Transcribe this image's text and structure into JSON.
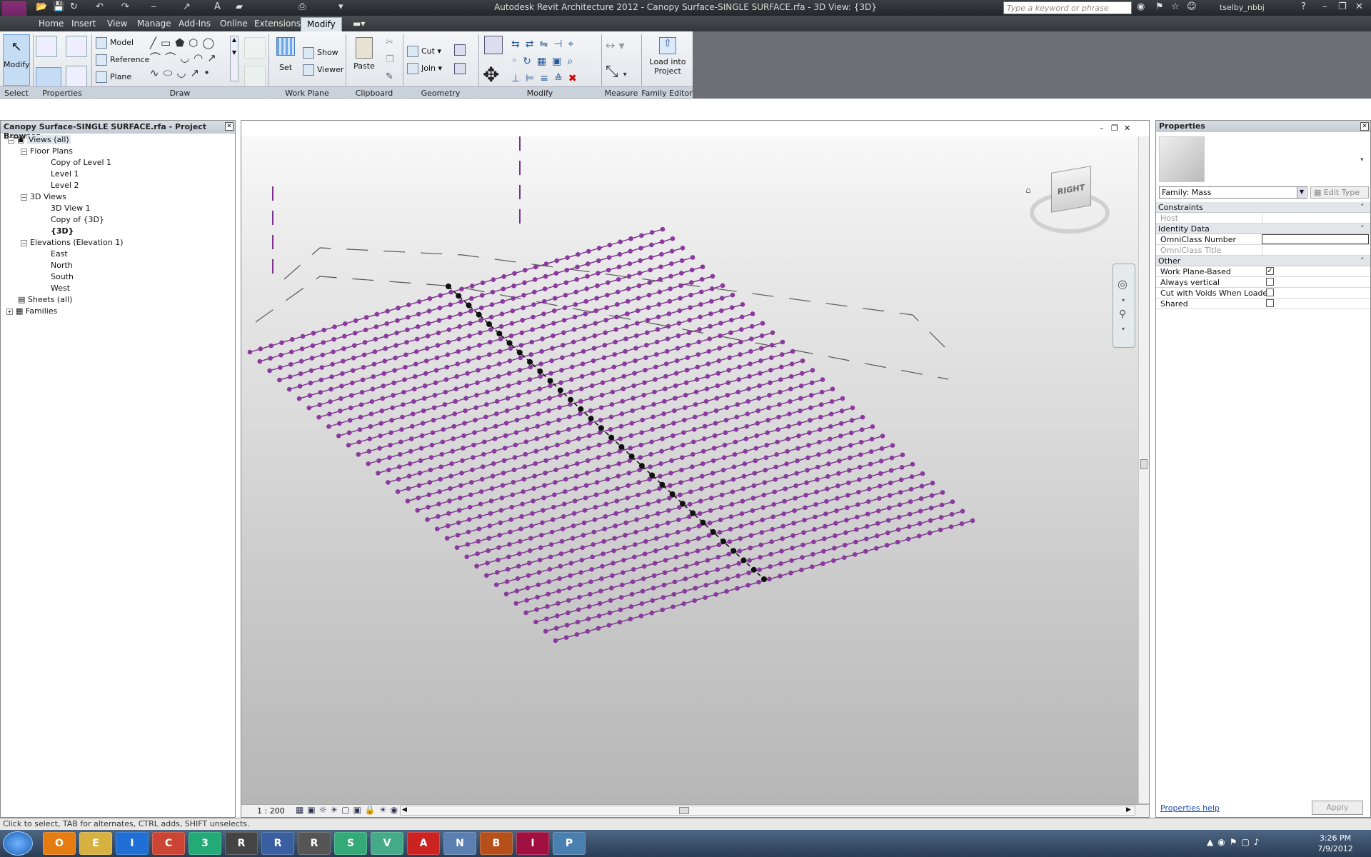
{
  "app": {
    "window_title": "Autodesk Revit Architecture 2012 -    Canopy Surface-SINGLE SURFACE.rfa - 3D View: {3D}",
    "search_placeholder": "Type a keyword or phrase",
    "user": "tselby_nbbj"
  },
  "tabs": [
    "Home",
    "Insert",
    "View",
    "Manage",
    "Add-Ins",
    "Online",
    "Extensions",
    "Modify"
  ],
  "active_tab": "Modify",
  "ribbon": {
    "select": {
      "modify": "Modify",
      "label": "Select"
    },
    "properties": {
      "label": "Properties"
    },
    "draw": {
      "model": "Model",
      "reference": "Reference",
      "plane": "Plane",
      "label": "Draw"
    },
    "work_plane": {
      "set": "Set",
      "show": "Show",
      "viewer": "Viewer",
      "label": "Work Plane"
    },
    "clipboard": {
      "paste": "Paste",
      "label": "Clipboard"
    },
    "geometry": {
      "cut": "Cut",
      "join": "Join",
      "label": "Geometry"
    },
    "modify": {
      "label": "Modify"
    },
    "measure": {
      "label": "Measure"
    },
    "family_editor": {
      "load": "Load into Project",
      "label": "Family Editor"
    }
  },
  "project_browser": {
    "title": "Canopy Surface-SINGLE SURFACE.rfa - Project Browser",
    "views_all": "Views (all)",
    "floor_plans": "Floor Plans",
    "fp1": "Copy of Level 1",
    "fp2": "Level 1",
    "fp3": "Level 2",
    "views3d": "3D Views",
    "v1": "3D View 1",
    "v2": "Copy of {3D}",
    "v3": "{3D}",
    "elevations": "Elevations (Elevation 1)",
    "e1": "East",
    "e2": "North",
    "e3": "South",
    "e4": "West",
    "sheets": "Sheets (all)",
    "families": "Families"
  },
  "viewport": {
    "scale": "1 : 200",
    "viewcube_face": "RIGHT",
    "colors": {
      "line": "#7b2f8e",
      "node": "#8a3a9e",
      "selected": "#111111"
    }
  },
  "properties": {
    "title": "Properties",
    "family": "Family: Mass",
    "edit_type": "Edit Type",
    "constraints": "Constraints",
    "host": "Host",
    "identity": "Identity Data",
    "omniclass_number": "OmniClass Number",
    "omniclass_title": "OmniClass Title",
    "other": "Other",
    "work_plane_based": "Work Plane-Based",
    "always_vertical": "Always vertical",
    "cut_with_voids": "Cut with Voids When Loaded",
    "shared": "Shared",
    "help": "Properties help",
    "apply": "Apply"
  },
  "status_bar": "Click to select, TAB for alternates, CTRL adds, SHIFT unselects.",
  "taskbar": {
    "clock_time": "3:26 PM",
    "clock_date": "7/9/2012",
    "apps": [
      "Outlook",
      "Explorer",
      "Internet Explorer",
      "Chrome",
      "3ds Max",
      "Rhino",
      "Remote Desktop",
      "Revit",
      "Solidworks",
      "Visio",
      "Acrobat",
      "Navisworks",
      "Bridge",
      "InDesign",
      "Photos"
    ]
  }
}
